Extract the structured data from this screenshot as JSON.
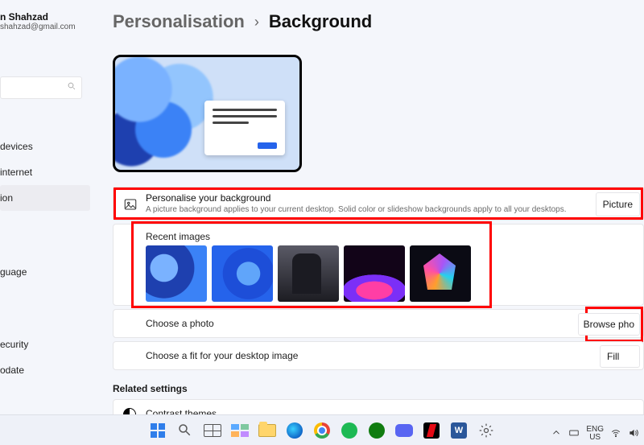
{
  "profile": {
    "name_fragment": "n Shahzad",
    "email_fragment": "shahzad@gmail.com"
  },
  "sidebar": {
    "items_top": [
      {
        "label": "devices"
      },
      {
        "label": "internet"
      },
      {
        "label": "ion",
        "selected": true
      }
    ],
    "items_bottom": [
      {
        "label": "guage"
      },
      {
        "label": "ecurity"
      },
      {
        "label": "odate"
      }
    ]
  },
  "breadcrumb": {
    "level1": "Personalisation",
    "level2": "Background"
  },
  "personalise_card": {
    "title": "Personalise your background",
    "subtitle": "A picture background applies to your current desktop. Solid color or slideshow backgrounds apply to all your desktops.",
    "dropdown_value": "Picture"
  },
  "recent": {
    "label": "Recent images",
    "thumbs": [
      "bloom-blue-1",
      "bloom-blue-2",
      "portrait-dark",
      "purple-eclipse",
      "neon-flower"
    ]
  },
  "choose_photo": {
    "label": "Choose a photo",
    "button": "Browse pho"
  },
  "choose_fit": {
    "label": "Choose a fit for your desktop image",
    "dropdown_value": "Fill"
  },
  "related": {
    "heading": "Related settings",
    "contrast": "Contrast themes"
  },
  "taskbar": {
    "lang_top": "ENG",
    "lang_bottom": "US"
  }
}
